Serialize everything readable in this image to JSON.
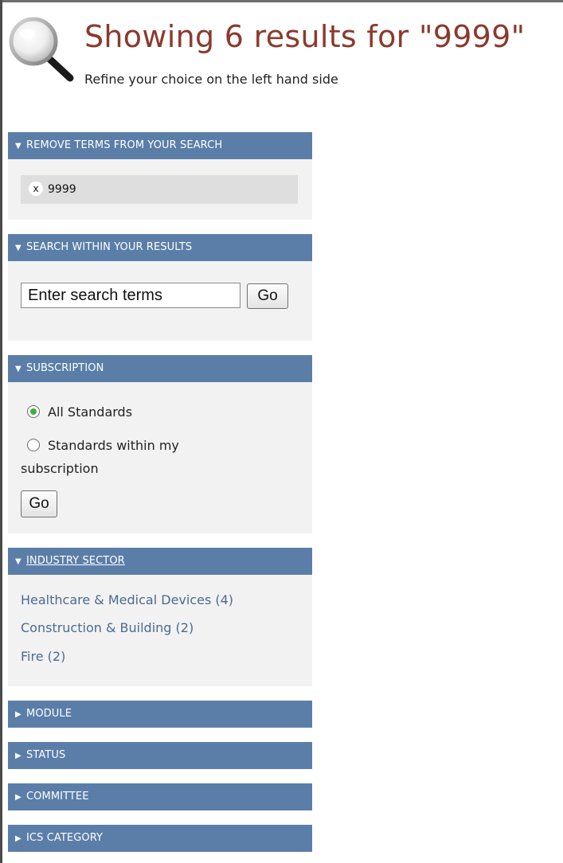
{
  "header": {
    "title": "Showing 6 results for \"9999\"",
    "subtitle": "Refine your choice on the left hand side"
  },
  "remove_terms": {
    "heading": "REMOVE TERMS FROM YOUR SEARCH",
    "remove_glyph": "x",
    "terms": [
      "9999"
    ]
  },
  "search_within": {
    "heading": "SEARCH WITHIN YOUR RESULTS",
    "input_value": "Enter search terms",
    "go_label": "Go"
  },
  "subscription": {
    "heading": "SUBSCRIPTION",
    "options": [
      {
        "label": "All Standards",
        "selected": true
      },
      {
        "label_line1": "Standards within my",
        "label_line2": "subscription",
        "selected": false
      }
    ],
    "go_label": "Go"
  },
  "industry_sector": {
    "heading": "INDUSTRY SECTOR",
    "items": [
      "Healthcare & Medical Devices (4)",
      "Construction & Building (2)",
      "Fire (2)"
    ]
  },
  "collapsed_panels": {
    "module": "MODULE",
    "status": "STATUS",
    "committee": "COMMITTEE",
    "ics_category": "ICS CATEGORY"
  },
  "icons": {
    "header": "magnifier-icon",
    "expanded": "triangle-down-icon",
    "collapsed": "triangle-right-icon"
  },
  "colors": {
    "title": "#8b3a2e",
    "panel_bar": "#5b7ea8",
    "panel_body": "#f2f2f2",
    "link": "#4b6b91",
    "radio_checked": "#3fae3f"
  }
}
